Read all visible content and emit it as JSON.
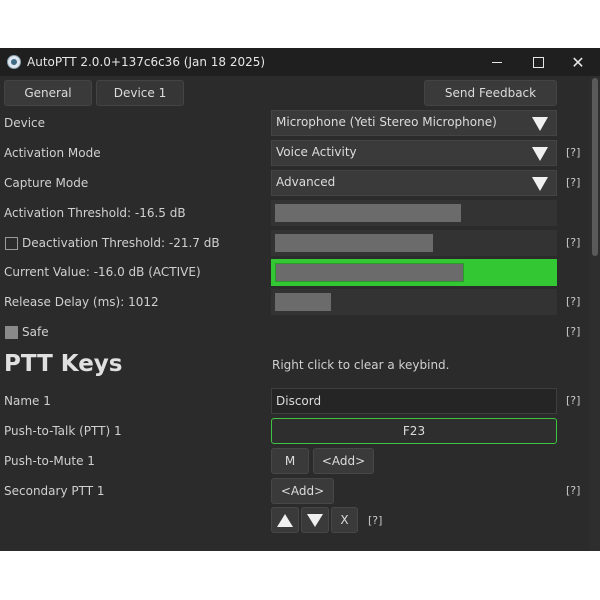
{
  "window": {
    "title": "AutoPTT 2.0.0+137c6c36 (Jan 18 2025)",
    "controls": {
      "minimize": "",
      "maximize": "",
      "close": "✕"
    }
  },
  "tabs": [
    {
      "label": "General",
      "active": false
    },
    {
      "label": "Device 1",
      "active": true
    }
  ],
  "send_feedback_label": "Send Feedback",
  "device": {
    "label": "Device",
    "value": "Microphone (Yeti Stereo Microphone)"
  },
  "activation_mode": {
    "label": "Activation Mode",
    "value": "Voice Activity",
    "help": "[?]"
  },
  "capture_mode": {
    "label": "Capture Mode",
    "value": "Advanced",
    "help": "[?]"
  },
  "activation_threshold": {
    "label": "Activation Threshold: -16.5 dB",
    "fill_fraction": 0.67
  },
  "deactivation_threshold": {
    "label": "Deactivation Threshold: -21.7 dB",
    "checked": false,
    "fill_fraction": 0.57,
    "help": "[?]"
  },
  "current_value": {
    "label": "Current Value: -16.0 dB (ACTIVE)",
    "fill_fraction": 0.68,
    "active_color": "#33c733"
  },
  "release_delay": {
    "label": "Release Delay (ms): 1012",
    "fill_fraction": 0.2,
    "help": "[?]"
  },
  "safe": {
    "label": "Safe",
    "checked": true,
    "help": "[?]"
  },
  "ptt_keys": {
    "heading": "PTT Keys",
    "hint": "Right click to clear a keybind."
  },
  "name1": {
    "label": "Name 1",
    "value": "Discord",
    "help": "[?]"
  },
  "ptt1": {
    "label": "Push-to-Talk (PTT) 1",
    "key": "F23"
  },
  "ptm1": {
    "label": "Push-to-Mute 1",
    "key": "M",
    "add_label": "<Add>"
  },
  "secondary_ptt1": {
    "label": "Secondary PTT 1",
    "add_label": "<Add>",
    "help": "[?]"
  },
  "row_controls": {
    "remove_label": "X",
    "help": "[?]"
  },
  "icons": {
    "app": "app-logo-icon",
    "dropdown": "triangle-down-icon",
    "move_up": "triangle-up-icon",
    "move_down": "triangle-down-icon"
  },
  "colors": {
    "background": "#2b2b2b",
    "titlebar": "#1f1f1f",
    "accent_green": "#33c733"
  }
}
